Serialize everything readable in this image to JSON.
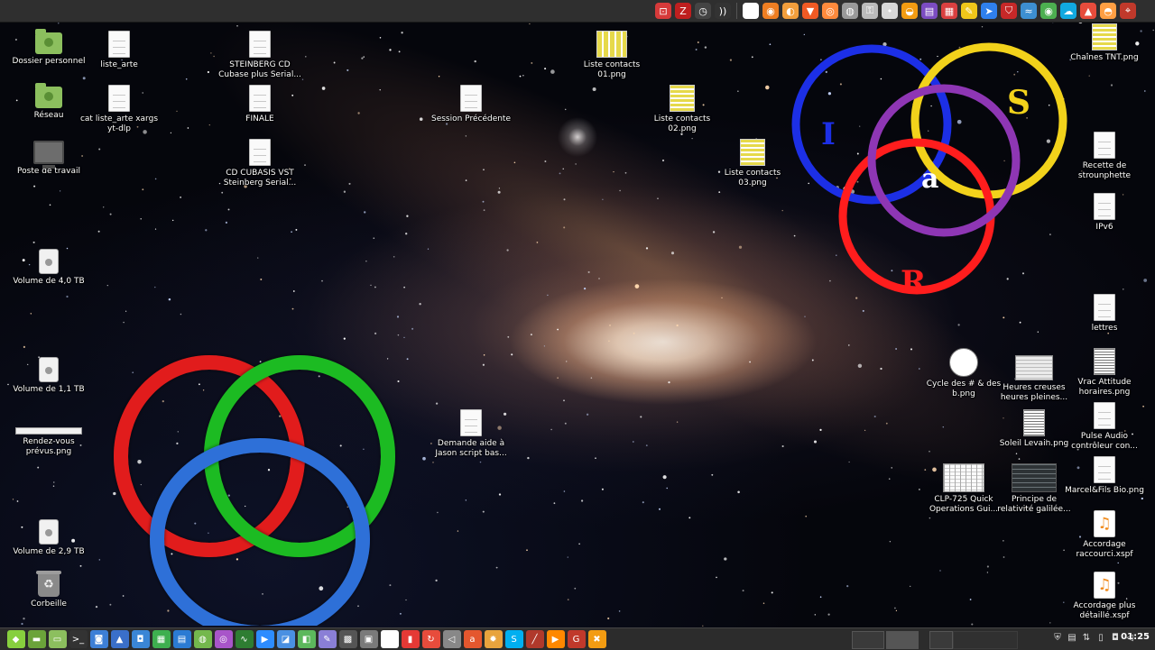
{
  "top_panel": {
    "tray_icons": [
      {
        "name": "gaming-icon",
        "color": "#d63a3a",
        "glyph": "⊡"
      },
      {
        "name": "filezilla-icon",
        "color": "#bf1f1f",
        "glyph": "Z"
      },
      {
        "name": "clock-icon",
        "color": "#444444",
        "glyph": "◷"
      },
      {
        "name": "sound-wave-icon",
        "color": "#333333",
        "glyph": "))"
      },
      {
        "name": "stopwatch-icon",
        "color": "#ffffff",
        "glyph": "◴"
      },
      {
        "name": "firefox-icon",
        "color": "#ef7e22",
        "glyph": "◉"
      },
      {
        "name": "crow-icon",
        "color": "#f29e3c",
        "glyph": "◐"
      },
      {
        "name": "brave-icon",
        "color": "#f05a24",
        "glyph": "▼"
      },
      {
        "name": "browser-icon",
        "color": "#ff8a3c",
        "glyph": "◎"
      },
      {
        "name": "remote-icon",
        "color": "#9a9a9a",
        "glyph": "◍"
      },
      {
        "name": "lock-icon",
        "color": "#bbbbbb",
        "glyph": "⚿"
      },
      {
        "name": "dot-icon",
        "color": "#d8d8d8",
        "glyph": "•"
      },
      {
        "name": "pizza-icon",
        "color": "#f39c12",
        "glyph": "◒"
      },
      {
        "name": "image-viewer-icon",
        "color": "#7b4cc2",
        "glyph": "▤"
      },
      {
        "name": "apps-icon",
        "color": "#d94040",
        "glyph": "▦"
      },
      {
        "name": "notes-icon",
        "color": "#f0c61a",
        "glyph": "✎"
      },
      {
        "name": "arrow-icon",
        "color": "#2f80ed",
        "glyph": "➤"
      },
      {
        "name": "shield-icon",
        "color": "#c62828",
        "glyph": "⛉"
      },
      {
        "name": "wave-icon",
        "color": "#3d8fd1",
        "glyph": "≈"
      },
      {
        "name": "chrome-icon",
        "color": "#4caf50",
        "glyph": "◉"
      },
      {
        "name": "cloud-icon",
        "color": "#11a9e0",
        "glyph": "☁"
      },
      {
        "name": "flame-icon",
        "color": "#e74c3c",
        "glyph": "▲"
      },
      {
        "name": "fox-icon",
        "color": "#ff9f43",
        "glyph": "◓"
      },
      {
        "name": "map-icon",
        "color": "#c0392b",
        "glyph": "⌖"
      }
    ]
  },
  "desktop": {
    "left_column": [
      {
        "label": "Dossier personnel",
        "kind": "folder",
        "name": "home-folder-icon"
      },
      {
        "label": "Réseau",
        "kind": "folder",
        "name": "network-folder-icon"
      },
      {
        "label": "Poste de travail",
        "kind": "monitor",
        "name": "computer-icon"
      },
      {
        "label": "Volume de 4,0 TB",
        "kind": "drive",
        "name": "drive-4tb-icon"
      },
      {
        "label": "Volume de 1,1 TB",
        "kind": "drive",
        "name": "drive-1tb-icon"
      },
      {
        "label": "Rendez-vous prévus.png",
        "kind": "bar",
        "name": "rendez-vous-image-icon"
      },
      {
        "label": "Volume de 2,9 TB",
        "kind": "drive",
        "name": "drive-29tb-icon"
      },
      {
        "label": "Corbeille",
        "kind": "trash",
        "name": "trash-icon"
      }
    ],
    "files": [
      {
        "label": "liste_arte",
        "kind": "doc"
      },
      {
        "label": "cat liste_arte xargs yt-dlp",
        "kind": "doc"
      },
      {
        "label": "STEINBERG CD Cubase plus Serial...",
        "kind": "doc"
      },
      {
        "label": "FINALE",
        "kind": "doc"
      },
      {
        "label": "CD CUBASIS VST Steinberg Serial...",
        "kind": "doc"
      },
      {
        "label": "Session Précédente",
        "kind": "doc"
      },
      {
        "label": "Demande aide à Jason script bas...",
        "kind": "doc"
      },
      {
        "label": "Liste contacts 01.png",
        "kind": "sheet-wide"
      },
      {
        "label": "Liste contacts 02.png",
        "kind": "sheet-yel"
      },
      {
        "label": "Liste contacts 03.png",
        "kind": "sheet-yel"
      },
      {
        "label": "Cycle des # & des b.png",
        "kind": "clock"
      },
      {
        "label": "Heures creuses heures pleines...",
        "kind": "screen"
      },
      {
        "label": "Soleil Levain.png",
        "kind": "striped"
      },
      {
        "label": "CLP-725 Quick Operations Gui...",
        "kind": "table"
      },
      {
        "label": "Principe de relativité galilée...",
        "kind": "dark"
      }
    ],
    "right_column": [
      {
        "label": "Chaînes TNT.png",
        "kind": "sheet-yel"
      },
      {
        "label": "Recette de strounphette",
        "kind": "doc"
      },
      {
        "label": "IPv6",
        "kind": "doc"
      },
      {
        "label": "lettres",
        "kind": "doc"
      },
      {
        "label": "Vrac Attitude horaires.png",
        "kind": "striped"
      },
      {
        "label": "Pulse Audio contrôleur con...",
        "kind": "doc"
      },
      {
        "label": "Marcel&Fils Bio.png",
        "kind": "doc"
      },
      {
        "label": "Accordage raccourci.xspf",
        "kind": "audio"
      },
      {
        "label": "Accordage plus détaillé.xspf",
        "kind": "audio"
      }
    ],
    "logo": {
      "letters": {
        "top_left": "I",
        "top_right": "S",
        "center": "a",
        "bottom": "R"
      },
      "colors": {
        "blue": "#1c2fe6",
        "yellow": "#f2d21b",
        "purple": "#8e36b4",
        "red": "#ff1d1d"
      }
    },
    "rings": {
      "red": "#e11f1f",
      "green": "#1dbb24",
      "blue": "#2e6fd8"
    }
  },
  "bottom_panel": {
    "launchers": [
      {
        "name": "menu-icon",
        "color": "#87cf3e",
        "glyph": "◆"
      },
      {
        "name": "files-icon",
        "color": "#6ba33a",
        "glyph": "▬"
      },
      {
        "name": "folder-icon",
        "color": "#8cbf5e",
        "glyph": "▭"
      },
      {
        "name": "terminal-icon",
        "color": "#333333",
        "glyph": ">_"
      },
      {
        "name": "screenshot-icon",
        "color": "#3d7fd6",
        "glyph": "◙"
      },
      {
        "name": "scanner-icon",
        "color": "#3a6fc9",
        "glyph": "▲"
      },
      {
        "name": "camera-icon",
        "color": "#3a86d6",
        "glyph": "◘"
      },
      {
        "name": "calc-icon",
        "color": "#3eaf4f",
        "glyph": "▦"
      },
      {
        "name": "writer-icon",
        "color": "#2b7bd3",
        "glyph": "▤"
      },
      {
        "name": "gimp-icon",
        "color": "#74b84d",
        "glyph": "◍"
      },
      {
        "name": "podcast-icon",
        "color": "#a855c9",
        "glyph": "◎"
      },
      {
        "name": "monitor-icon",
        "color": "#2e7d32",
        "glyph": "∿"
      },
      {
        "name": "zoom-icon",
        "color": "#2d8cff",
        "glyph": "▶"
      },
      {
        "name": "chat-icon",
        "color": "#4a90e2",
        "glyph": "◪"
      },
      {
        "name": "toggle-icon",
        "color": "#5cb85c",
        "glyph": "◧"
      },
      {
        "name": "editor-icon",
        "color": "#8a7fd6",
        "glyph": "✎"
      },
      {
        "name": "tools-icon",
        "color": "#555555",
        "glyph": "▩"
      },
      {
        "name": "clipboard-icon",
        "color": "#7a7a7a",
        "glyph": "▣"
      },
      {
        "name": "spade-icon",
        "color": "#ffffff",
        "glyph": "♠"
      },
      {
        "name": "book-icon",
        "color": "#e53935",
        "glyph": "▮"
      },
      {
        "name": "sync-icon",
        "color": "#e74c3c",
        "glyph": "↻"
      },
      {
        "name": "speaker-icon",
        "color": "#888888",
        "glyph": "◁"
      },
      {
        "name": "arte-icon",
        "color": "#e4572e",
        "glyph": "a"
      },
      {
        "name": "gear-icon",
        "color": "#e8a33d",
        "glyph": "✹"
      },
      {
        "name": "skype-icon",
        "color": "#00aff0",
        "glyph": "S"
      },
      {
        "name": "pipe-icon",
        "color": "#b0392b",
        "glyph": "╱"
      },
      {
        "name": "player-icon",
        "color": "#ff8800",
        "glyph": "▶"
      },
      {
        "name": "gtick-icon",
        "color": "#c0392b",
        "glyph": "G"
      },
      {
        "name": "crossfire-icon",
        "color": "#f39c12",
        "glyph": "✖"
      }
    ],
    "clock": "01:25"
  }
}
